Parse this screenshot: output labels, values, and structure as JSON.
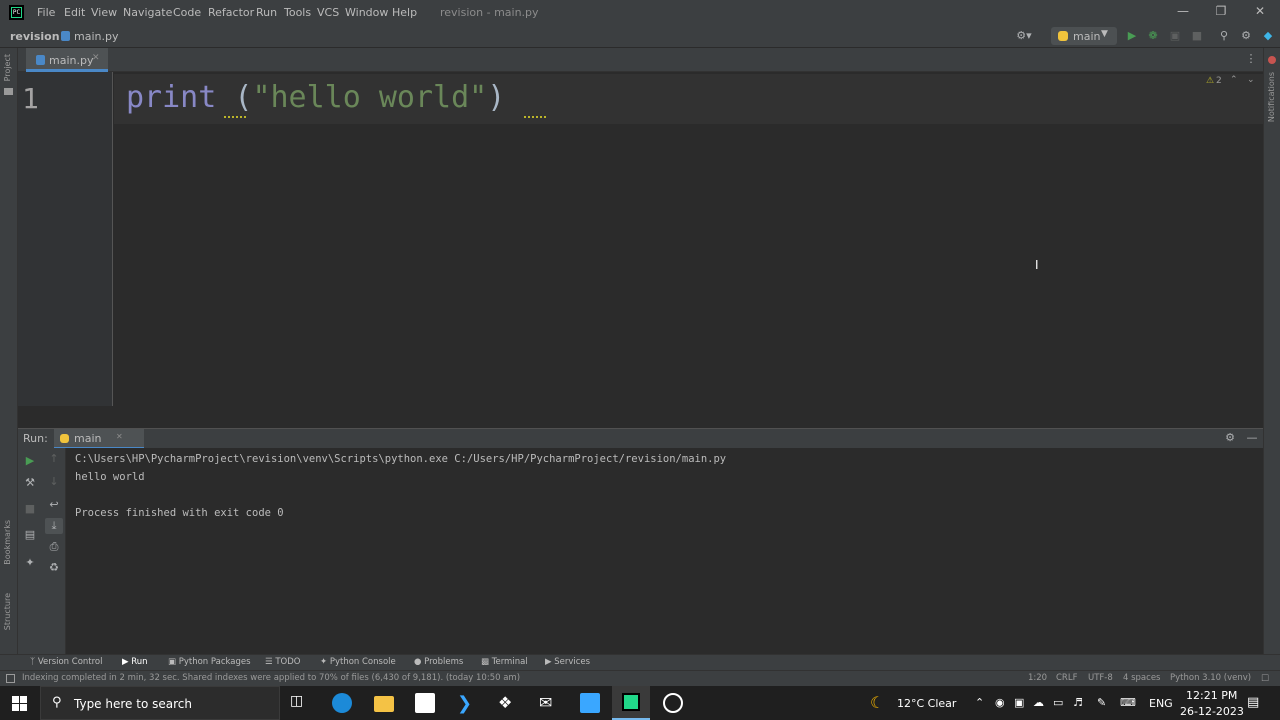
{
  "app": {
    "logo_text": "PC",
    "menu": [
      "File",
      "Edit",
      "View",
      "Navigate",
      "Code",
      "Refactor",
      "Run",
      "Tools",
      "VCS",
      "Window",
      "Help"
    ],
    "window_title": "revision - main.py"
  },
  "navbar": {
    "project": "revision",
    "file": "main.py",
    "run_config": "main"
  },
  "left_strip": {
    "project_label": "Project",
    "bookmarks_label": "Bookmarks",
    "structure_label": "Structure"
  },
  "right_strip": {
    "notifications_label": "Notifications"
  },
  "editor": {
    "tab_label": "main.py",
    "line_number": "1",
    "code": {
      "func": "print",
      "open_paren": " (",
      "string": "\"hello world\"",
      "close_paren": ")"
    },
    "inspection_count": "2"
  },
  "run_panel": {
    "label": "Run:",
    "tab_label": "main",
    "console_lines": [
      "C:\\Users\\HP\\PycharmProject\\revision\\venv\\Scripts\\python.exe C:/Users/HP/PycharmProject/revision/main.py",
      "hello world",
      "",
      "Process finished with exit code 0"
    ]
  },
  "tool_windows": [
    "Version Control",
    "Run",
    "Python Packages",
    "TODO",
    "Python Console",
    "Problems",
    "Terminal",
    "Services"
  ],
  "statusbar": {
    "message": "Indexing completed in 2 min, 32 sec. Shared indexes were applied to 70% of files (6,430 of 9,181). (today 10:50 am)",
    "position": "1:20",
    "line_ending": "CRLF",
    "encoding": "UTF-8",
    "indent": "4 spaces",
    "interpreter": "Python 3.10 (venv)"
  },
  "taskbar": {
    "search_placeholder": "Type here to search",
    "weather": "12°C  Clear",
    "language": "ENG",
    "time": "12:21 PM",
    "date": "26-12-2023"
  },
  "colors": {
    "keyword_func": "#8888c6",
    "string": "#6a8759",
    "text": "#a9b7c6",
    "accent": "#4a88c7",
    "run_green": "#499c54"
  }
}
